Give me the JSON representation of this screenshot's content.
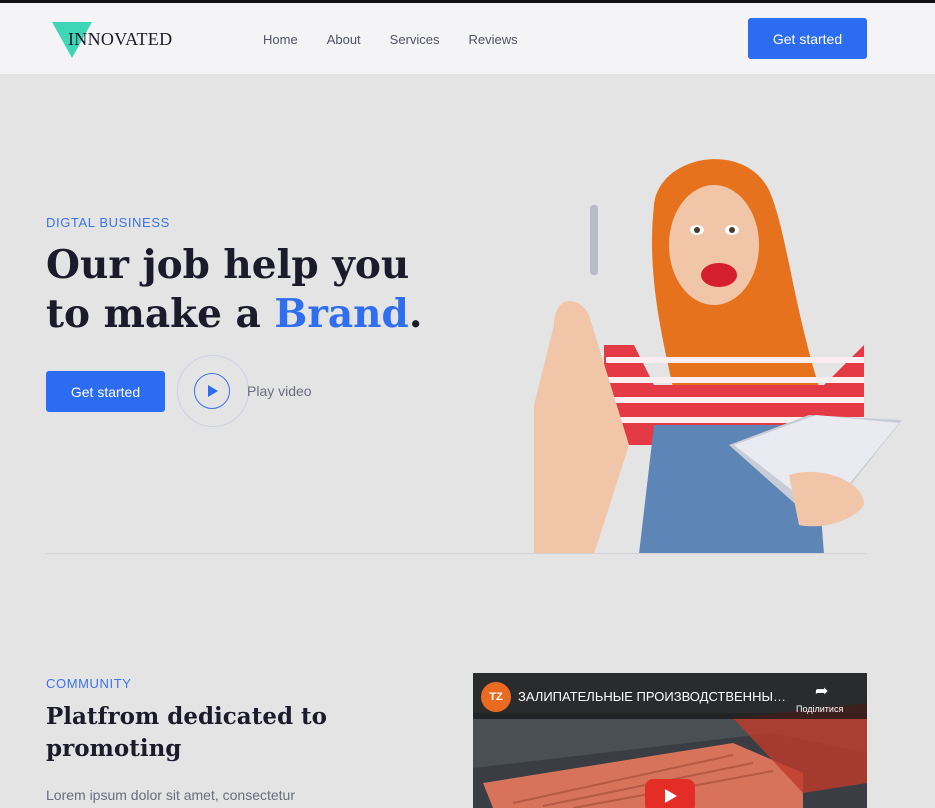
{
  "header": {
    "logo_text": "INNOVATED",
    "nav": [
      "Home",
      "About",
      "Services",
      "Reviews"
    ],
    "cta_label": "Get started"
  },
  "hero": {
    "eyebrow": "DIGTAL BUSINESS",
    "title_line1": "Our job help you",
    "title_line2_prefix": "to make a ",
    "title_accent": "Brand",
    "title_suffix": ".",
    "cta_label": "Get started",
    "play_label": "Play video"
  },
  "community": {
    "eyebrow": "COMMUNITY",
    "title": "Platfrom dedicated to promoting",
    "text": "Lorem ipsum dolor sit amet, consectetur"
  },
  "video": {
    "channel_badge": "TZ",
    "title": "ЗАЛИПАТЕЛЬНЫЕ ПРОИЗВОДСТВЕННЫЕ ...",
    "share_label": "Поділитися"
  },
  "colors": {
    "accent": "#2c6cf2",
    "logo_teal": "#3fd6b5",
    "background": "#e4e4e5",
    "header_bg": "#f4f4f6"
  }
}
